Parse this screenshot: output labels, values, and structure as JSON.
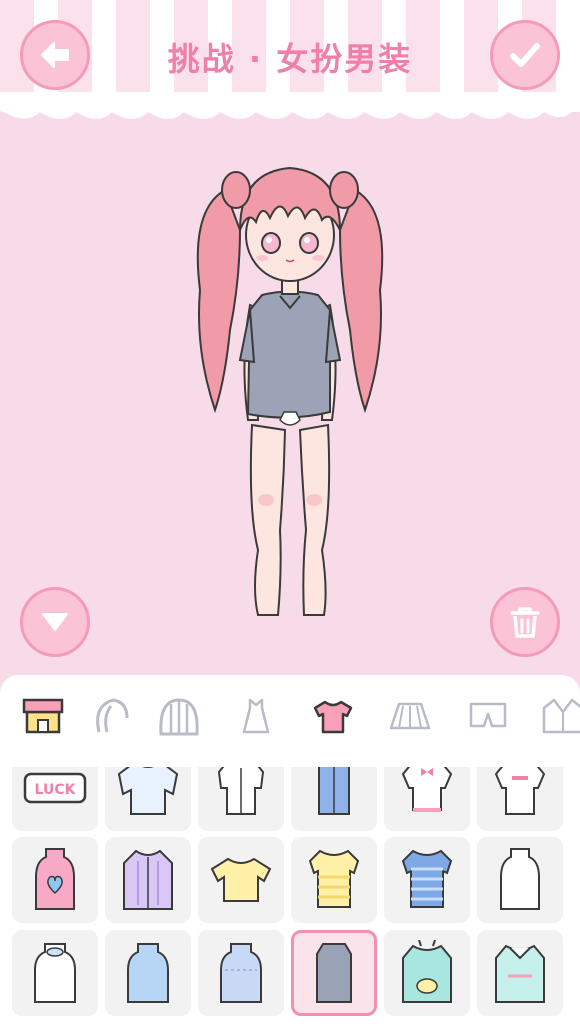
{
  "header": {
    "title": "挑战 · 女扮男装",
    "back_icon": "back-arrow-icon",
    "confirm_icon": "checkmark-icon"
  },
  "stage": {
    "collapse_icon": "triangle-down-icon",
    "trash_icon": "trash-icon"
  },
  "categories": [
    {
      "icon": "shop-icon",
      "selected": false
    },
    {
      "icon": "hair-icon",
      "selected": false
    },
    {
      "icon": "wig-icon",
      "selected": false
    },
    {
      "icon": "dress-icon",
      "selected": false
    },
    {
      "icon": "tshirt-icon",
      "selected": true
    },
    {
      "icon": "skirt-icon",
      "selected": false
    },
    {
      "icon": "shorts-icon",
      "selected": false
    },
    {
      "icon": "jacket-icon",
      "selected": false
    }
  ],
  "items": [
    {
      "icon": "luck-badge-icon",
      "color": "#f7a9c6",
      "text": "LUCK"
    },
    {
      "icon": "ruffle-blouse-icon",
      "color": "#e8f2ff"
    },
    {
      "icon": "white-shirt-icon",
      "color": "#ffffff"
    },
    {
      "icon": "blue-sleeveless-top-icon",
      "color": "#8fb2ea"
    },
    {
      "icon": "bow-top-icon",
      "color": "#ffffff"
    },
    {
      "icon": "love-tee-icon",
      "color": "#ffffff"
    },
    {
      "icon": "heart-tank-icon",
      "color": "#f7a9c6"
    },
    {
      "icon": "purple-cardigan-icon",
      "color": "#d9c7f5"
    },
    {
      "icon": "yellow-tee-icon",
      "color": "#fff2a8"
    },
    {
      "icon": "yellow-stripe-tee-icon",
      "color": "#fff2a8"
    },
    {
      "icon": "blue-stripe-tee-icon",
      "color": "#7fa9e6"
    },
    {
      "icon": "white-tank-icon",
      "color": "#ffffff"
    },
    {
      "icon": "white-blouse-icon",
      "color": "#ffffff"
    },
    {
      "icon": "blue-sweater-icon",
      "color": "#b7d6f5"
    },
    {
      "icon": "blue-tank-icon",
      "color": "#c8d9f5"
    },
    {
      "icon": "gray-long-tee-icon",
      "color": "#9aa2b5",
      "selected": true
    },
    {
      "icon": "bunny-hoodie-icon",
      "color": "#a9e6e0"
    },
    {
      "icon": "collar-shirt-icon",
      "color": "#c5f0ec"
    }
  ]
}
